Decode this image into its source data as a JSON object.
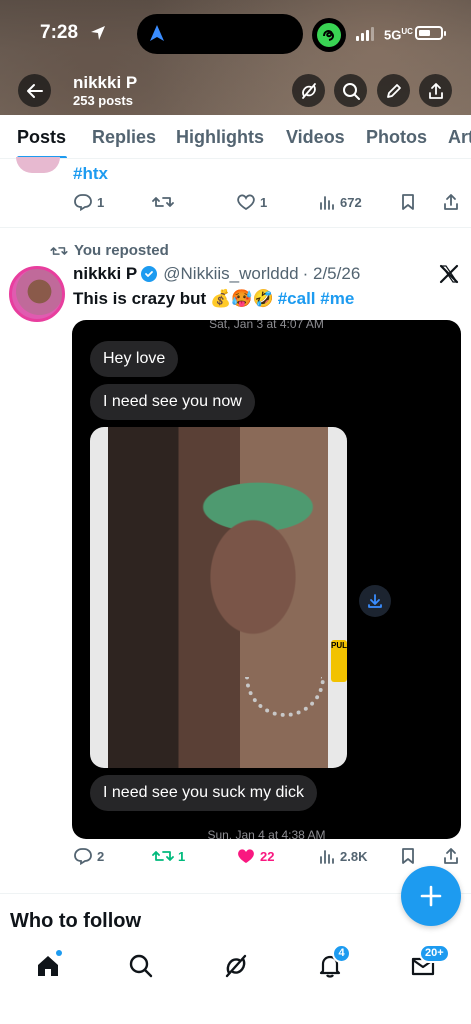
{
  "status_bar": {
    "time": "7:28",
    "network": "5G",
    "network_sup": "UC",
    "icons": [
      "location-arrow-icon",
      "navigation-icon",
      "app-activity-icon",
      "signal-icon",
      "battery-icon"
    ]
  },
  "profile": {
    "name": "nikkki P",
    "post_count": "253 posts",
    "header_buttons": [
      "back-icon",
      "grok-icon",
      "search-icon",
      "edit-icon",
      "share-icon"
    ]
  },
  "tabs": [
    {
      "label": "Posts",
      "active": true
    },
    {
      "label": "Replies"
    },
    {
      "label": "Highlights"
    },
    {
      "label": "Videos"
    },
    {
      "label": "Photos"
    },
    {
      "label": "Art"
    }
  ],
  "previous_post": {
    "hashtag": "#htx",
    "replies": "1",
    "retweets": "",
    "likes": "1",
    "views": "672"
  },
  "reposted_post": {
    "repost_label": "You reposted",
    "name": "nikkki P",
    "handle": "@Nikkiis_worlddd",
    "date": "· 2/5/26",
    "text_plain": "This is crazy but",
    "emojis": "💰🥵🤣",
    "hashtags": "#call #me",
    "media": {
      "timestamp_top": "Sat, Jan 3 at 4:07 AM",
      "messages": [
        "Hey love",
        "I need see you now",
        "I need see you suck my dick"
      ],
      "timestamp_bottom": "Sun, Jan 4 at 4:38 AM",
      "pull_label": "PULL"
    },
    "replies": "2",
    "retweets": "1",
    "likes": "22",
    "views": "2.8K",
    "like_color": "#f91880",
    "retweet_color": "#00ba7c"
  },
  "who_to_follow": "Who to follow",
  "bottom_nav": {
    "items": [
      "home-icon",
      "search-icon",
      "grok-icon",
      "notifications-icon",
      "messages-icon"
    ],
    "notifications_badge": "4",
    "messages_badge": "20+"
  },
  "accent": "#1d9bf0"
}
